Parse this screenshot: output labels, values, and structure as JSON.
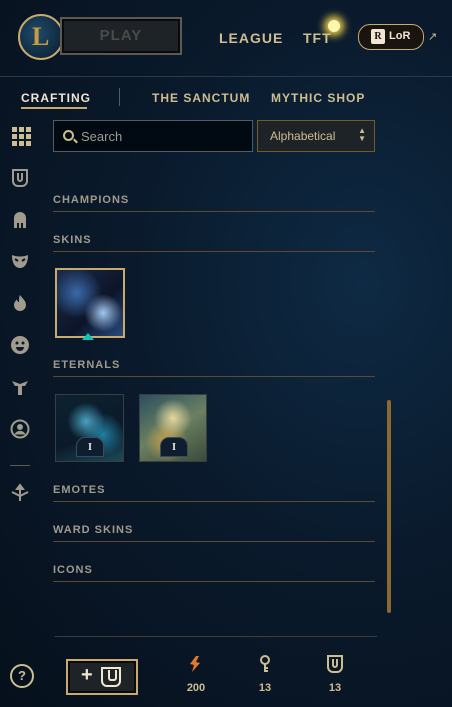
{
  "topbar": {
    "play_label": "PLAY",
    "nav": [
      "LEAGUE",
      "TFT"
    ],
    "lor_label": "LoR",
    "lor_logo_letter": "R",
    "logo_letter": "L"
  },
  "subnav": {
    "items": [
      "CRAFTING",
      "THE SANCTUM",
      "MYTHIC SHOP"
    ],
    "active": "CRAFTING"
  },
  "search": {
    "placeholder": "Search"
  },
  "sort": {
    "value": "Alphabetical"
  },
  "sidebar": {
    "icons": [
      "grid-icon",
      "chest-icon",
      "champion-helmet-icon",
      "skin-mask-icon",
      "flame-emote-icon",
      "smiley-emote-icon",
      "ward-icon",
      "profile-icon",
      "loot-arrow-icon"
    ]
  },
  "sections": [
    {
      "title": "CHAMPIONS"
    },
    {
      "title": "SKINS"
    },
    {
      "title": "ETERNALS"
    },
    {
      "title": "EMOTES"
    },
    {
      "title": "WARD SKINS"
    },
    {
      "title": "ICONS"
    }
  ],
  "eternals": [
    {
      "level": "I"
    },
    {
      "level": "I"
    }
  ],
  "footer": {
    "help_label": "?",
    "add_label": "+",
    "currencies": [
      {
        "icon": "blue-essence-icon",
        "value": "200"
      },
      {
        "icon": "key-icon",
        "value": "13"
      },
      {
        "icon": "chest-icon",
        "value": "13"
      }
    ]
  },
  "colors": {
    "gold": "#c8aa6e",
    "background": "#0a1a2c",
    "accent_teal": "#0ac8b9"
  }
}
